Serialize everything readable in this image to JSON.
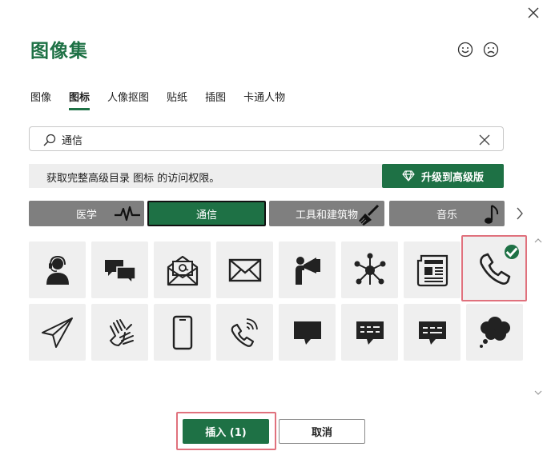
{
  "dialog": {
    "title": "图像集"
  },
  "tabs": [
    {
      "label": "图像",
      "active": false
    },
    {
      "label": "图标",
      "active": true
    },
    {
      "label": "人像抠图",
      "active": false
    },
    {
      "label": "贴纸",
      "active": false
    },
    {
      "label": "插图",
      "active": false
    },
    {
      "label": "卡通人物",
      "active": false
    }
  ],
  "search": {
    "value": "通信"
  },
  "upsell": {
    "text": "获取完整高级目录 图标 的访问权限。",
    "button": "升级到高级版"
  },
  "categories": [
    {
      "label": "医学",
      "icon": "heartbeat-icon"
    },
    {
      "label": "通信",
      "active": true
    },
    {
      "label": "工具和建筑物",
      "icon": "brush-icon"
    },
    {
      "label": "音乐",
      "icon": "music-note-icon"
    }
  ],
  "icons": [
    {
      "name": "headset-person-icon",
      "selected": false
    },
    {
      "name": "chat-bubbles-icon",
      "selected": false
    },
    {
      "name": "email-at-icon",
      "selected": false
    },
    {
      "name": "envelope-icon",
      "selected": false
    },
    {
      "name": "megaphone-person-icon",
      "selected": false
    },
    {
      "name": "network-hub-icon",
      "selected": false
    },
    {
      "name": "newspaper-icon",
      "selected": false
    },
    {
      "name": "phone-handset-icon",
      "selected": true
    },
    {
      "name": "paper-plane-icon",
      "selected": false
    },
    {
      "name": "sign-language-icon",
      "selected": false
    },
    {
      "name": "smartphone-icon",
      "selected": false
    },
    {
      "name": "phone-ringing-icon",
      "selected": false
    },
    {
      "name": "speech-bubble-icon",
      "selected": false
    },
    {
      "name": "text-message-bubble-icon",
      "selected": false
    },
    {
      "name": "text-message-bubble-alt-icon",
      "selected": false
    },
    {
      "name": "thought-bubble-icon",
      "selected": false
    }
  ],
  "footer": {
    "insert": "插入 (1)",
    "cancel": "取消"
  },
  "colors": {
    "accent": "#1e7145",
    "category_inactive": "#7f7f7f",
    "tile_bg": "#efefef",
    "selection_outline": "#e0717d"
  }
}
